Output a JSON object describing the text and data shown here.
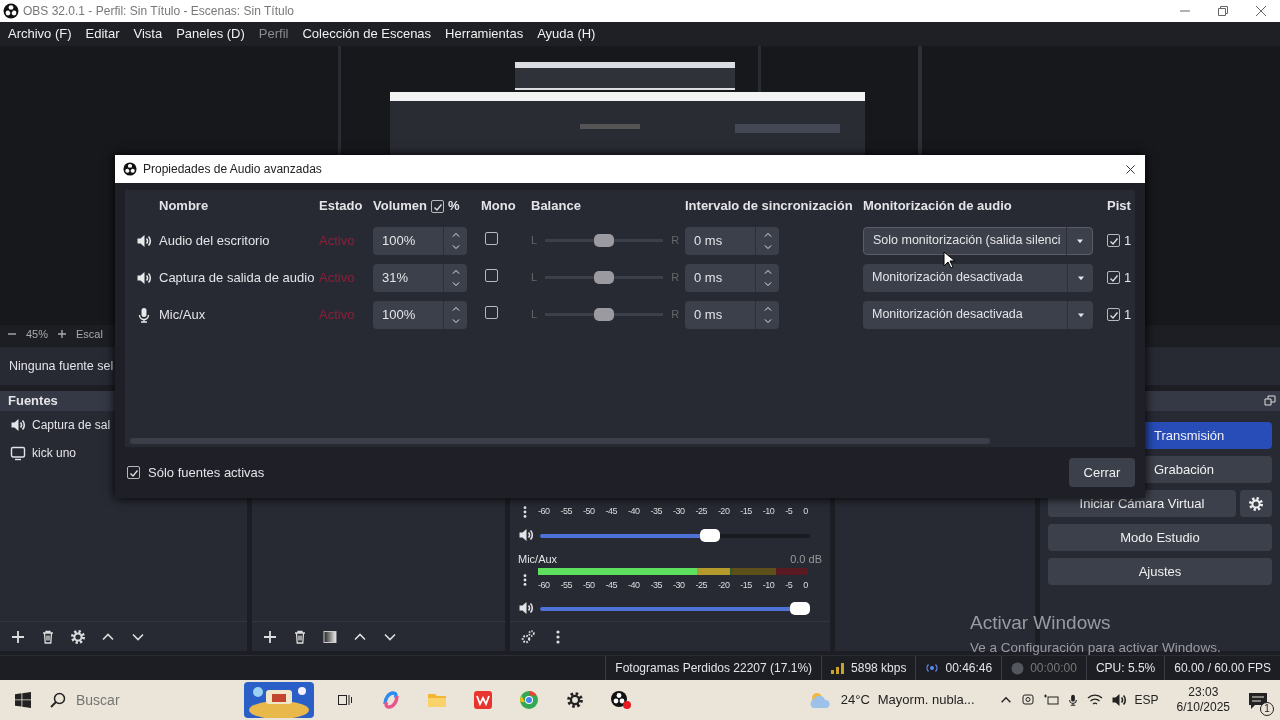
{
  "window": {
    "title": "OBS 32.0.1 - Perfil: Sin Título - Escenas: Sin Título"
  },
  "menu": [
    {
      "label": "Archivo (F)",
      "disabled": false
    },
    {
      "label": "Editar",
      "disabled": false
    },
    {
      "label": "Vista",
      "disabled": false
    },
    {
      "label": "Paneles (D)",
      "disabled": false
    },
    {
      "label": "Perfil",
      "disabled": true
    },
    {
      "label": "Colección de Escenas",
      "disabled": false
    },
    {
      "label": "Herramientas",
      "disabled": false
    },
    {
      "label": "Ayuda (H)",
      "disabled": false
    }
  ],
  "zoom_bar": {
    "zoom": "45%",
    "scale_label": "Escal"
  },
  "context_bar": {
    "text": "Ninguna fuente sel"
  },
  "sources": {
    "title": "Fuentes",
    "items": [
      {
        "kind": "audio",
        "label": "Captura de sal"
      },
      {
        "kind": "display",
        "label": "kick uno"
      }
    ]
  },
  "mixer": {
    "channels": [
      {
        "ticks": [
          "-60",
          "-55",
          "-50",
          "-45",
          "-40",
          "-35",
          "-30",
          "-25",
          "-20",
          "-15",
          "-10",
          "-5",
          "0"
        ],
        "level": 0.64
      },
      {
        "name": "Mic/Aux",
        "reading": "0.0 dB",
        "meter": {
          "level": 0.71
        },
        "ticks": [
          "-60",
          "-55",
          "-50",
          "-45",
          "-40",
          "-35",
          "-30",
          "-25",
          "-20",
          "-15",
          "-10",
          "-5",
          "0"
        ],
        "level": 1
      }
    ]
  },
  "controls": {
    "buttons": [
      {
        "label": "Transmisión",
        "active": true,
        "cut": true,
        "has_settings": false
      },
      {
        "label": "Grabación",
        "active": false,
        "cut": true,
        "has_settings": false
      },
      {
        "label": "Iniciar Cámara Virtual",
        "active": false,
        "cut": false,
        "has_settings": true
      },
      {
        "label": "Modo Estudio",
        "active": false,
        "cut": false,
        "has_settings": false
      },
      {
        "label": "Ajustes",
        "active": false,
        "cut": false,
        "has_settings": false
      }
    ]
  },
  "activation_notice": {
    "title": "Activar Windows",
    "text": "Ve a Configuración para activar Windows."
  },
  "status_bar": {
    "dropped_frames": "Fotogramas Perdidos 22207 (17.1%)",
    "bitrate": "5898 kbps",
    "stream_time": "00:46:46",
    "record_time": "00:00:00",
    "cpu": "CPU: 5.5%",
    "fps": "60.00 / 60.00 FPS"
  },
  "dialog": {
    "title": "Propiedades de Audio avanzadas",
    "columns": [
      "Nombre",
      "Estado",
      "Volumen",
      "%",
      "Mono",
      "Balance",
      "Intervalo de sincronización",
      "Monitorización de audio",
      "Pist"
    ],
    "volume_percent": true,
    "rows": [
      {
        "kind": "speaker",
        "name": "Audio del escritorio",
        "status": "Activo",
        "volume": "100%",
        "mono": false,
        "left": "L",
        "right": "R",
        "level": 0.5,
        "sync": "0 ms",
        "monitoring": "Solo monitorización (salida silenci",
        "track_enabled": true,
        "track": "1"
      },
      {
        "kind": "speaker",
        "name": "Captura de salida de audio",
        "status": "Activo",
        "volume": "31%",
        "mono": false,
        "left": "L",
        "right": "R",
        "level": 0.5,
        "sync": "0 ms",
        "monitoring": "Monitorización desactivada",
        "track_enabled": true,
        "track": "1"
      },
      {
        "kind": "mic",
        "name": "Mic/Aux",
        "status": "Activo",
        "volume": "100%",
        "mono": false,
        "left": "L",
        "right": "R",
        "level": 0.5,
        "sync": "0 ms",
        "monitoring": "Monitorización desactivada",
        "track_enabled": true,
        "track": "1"
      }
    ],
    "active_only": {
      "label": "Sólo fuentes activas",
      "checked": true
    },
    "close_button": "Cerrar"
  },
  "taskbar": {
    "search": {
      "placeholder": "Buscar"
    },
    "weather": "24°C",
    "forecast": "Mayorm. nubla...",
    "language": "ESP",
    "time": "23:03",
    "date": "6/10/2025",
    "notifications": "1"
  }
}
